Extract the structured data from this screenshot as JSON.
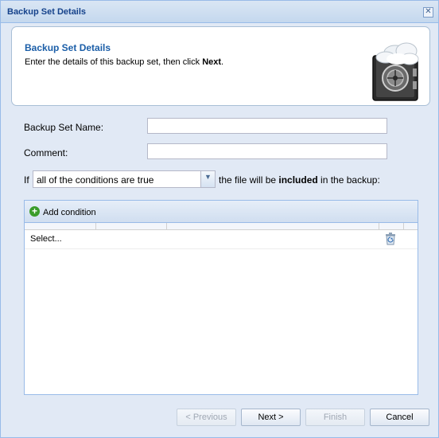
{
  "window": {
    "title": "Backup Set Details",
    "close_glyph": "✕"
  },
  "header": {
    "title": "Backup Set Details",
    "description_prefix": "Enter the details of this backup set, then click ",
    "description_bold": "Next",
    "description_suffix": ".",
    "icon": "vault-cloud-icon"
  },
  "form": {
    "name_label": "Backup Set Name:",
    "name_value": "",
    "comment_label": "Comment:",
    "comment_value": ""
  },
  "condition": {
    "if_label": "If",
    "selected": "all of the conditions are true",
    "text_prefix": "the file will be ",
    "text_bold": "included",
    "text_suffix": " in the backup:"
  },
  "grid": {
    "add_label": "Add condition",
    "rows": [
      {
        "value": "Select..."
      }
    ]
  },
  "buttons": {
    "previous": "< Previous",
    "next": "Next >",
    "finish": "Finish",
    "cancel": "Cancel"
  },
  "colors": {
    "title_text": "#15428b",
    "header_title": "#1b5ea8",
    "window_bg": "#e1e9f5",
    "add_icon": "#3a9c2a"
  }
}
